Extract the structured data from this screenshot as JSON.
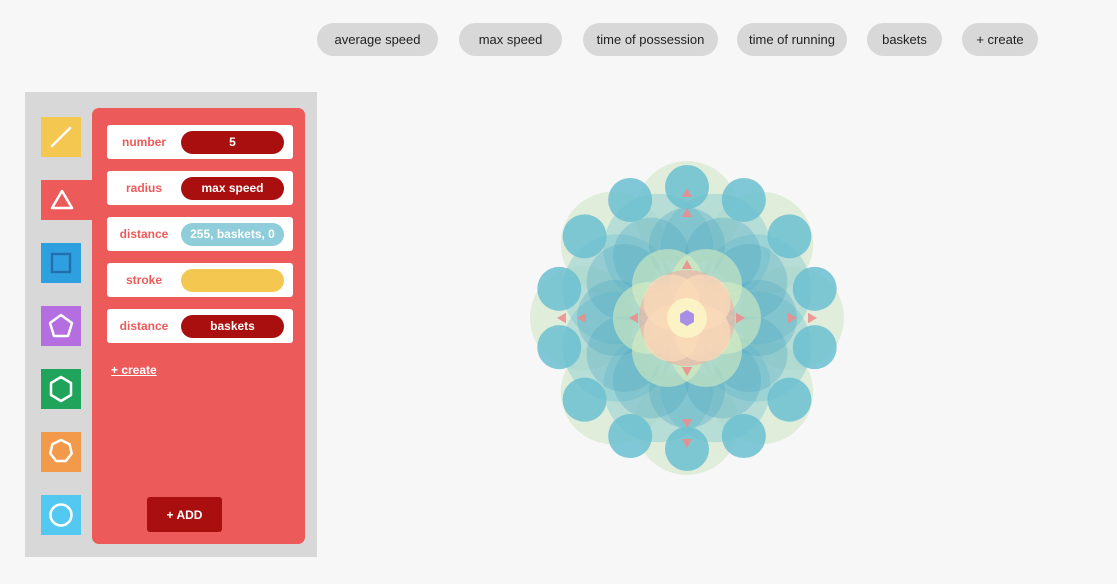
{
  "top_pills": [
    {
      "label": "average speed"
    },
    {
      "label": "max speed"
    },
    {
      "label": "time of possession"
    },
    {
      "label": "time of running"
    },
    {
      "label": "baskets"
    },
    {
      "label": "+ create"
    }
  ],
  "tools": [
    {
      "name": "line-tool",
      "icon": "line-icon",
      "color": "#f4c850"
    },
    {
      "name": "triangle-tool",
      "icon": "triangle-icon",
      "color": "#ed5a5a",
      "active": true
    },
    {
      "name": "square-tool",
      "icon": "square-icon",
      "color": "#2e9fdf"
    },
    {
      "name": "pentagon-tool",
      "icon": "pentagon-icon",
      "color": "#b56ee0"
    },
    {
      "name": "hexagon-tool",
      "icon": "hexagon-icon",
      "color": "#20a35a"
    },
    {
      "name": "heptagon-tool",
      "icon": "heptagon-icon",
      "color": "#f39a4a"
    },
    {
      "name": "circle-tool",
      "icon": "circle-icon",
      "color": "#53c8f0"
    }
  ],
  "properties": [
    {
      "label": "number",
      "value": "5"
    },
    {
      "label": "radius",
      "value": "max speed"
    },
    {
      "label": "distance",
      "value": "255, baskets, 0"
    },
    {
      "label": "stroke",
      "value": ""
    },
    {
      "label": "distance",
      "value": "baskets"
    }
  ],
  "panel": {
    "create_label": "+ create",
    "add_label": "+ ADD"
  },
  "colors": {
    "panel_bg": "#d8d8d8",
    "card_bg": "#ed5a5a",
    "dark_red": "#a90f0f",
    "teal": "#6bbfd1",
    "yellow": "#f4c850"
  }
}
